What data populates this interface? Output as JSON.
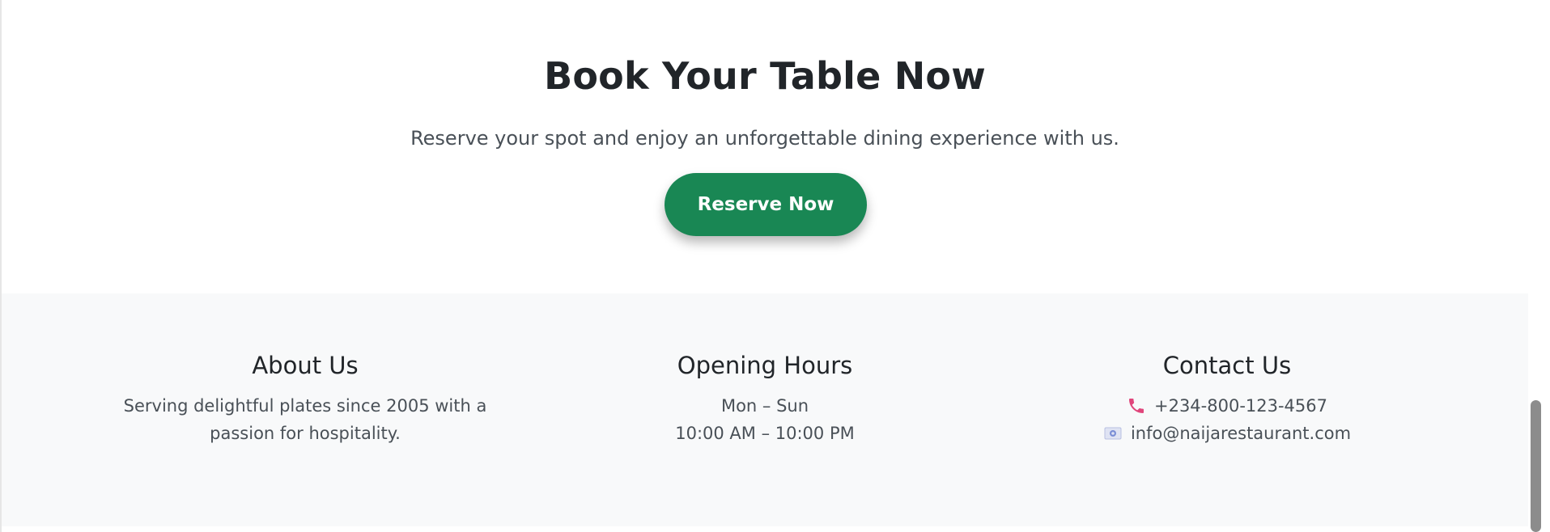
{
  "cta": {
    "title": "Book Your Table Now",
    "subtitle": "Reserve your spot and enjoy an unforgettable dining experience with us.",
    "button_label": "Reserve Now"
  },
  "footer": {
    "about": {
      "heading": "About Us",
      "text": "Serving delightful plates since 2005 with a passion for hospitality."
    },
    "hours": {
      "heading": "Opening Hours",
      "days": "Mon – Sun",
      "times": "10:00 AM – 10:00 PM"
    },
    "contact": {
      "heading": "Contact Us",
      "phone": "+234-800-123-4567",
      "phone_icon": "phone-icon",
      "email": "info@naijarestaurant.com",
      "email_icon": "email-icon"
    }
  },
  "colors": {
    "accent": "#198754",
    "footer_bg": "#f8f9fa",
    "heading_text": "#212529",
    "body_text": "#495057",
    "phone_icon": "#e0457b"
  }
}
